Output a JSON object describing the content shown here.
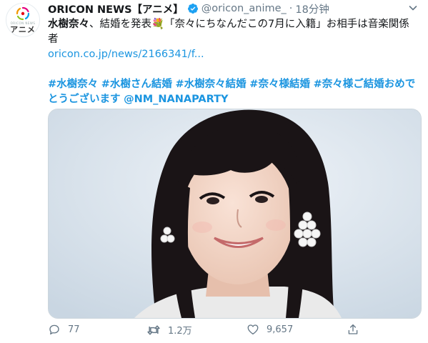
{
  "account": {
    "avatar_top_text": "ORICON NEWS",
    "avatar_label": "アニメ",
    "display_name": "ORICON NEWS【アニメ】",
    "handle": "@oricon_anime_",
    "separator": "·",
    "timestamp": "18分钟"
  },
  "tweet": {
    "bold_name": "水樹奈々",
    "body": "、結婚を発表💐「奈々にちなんだこの7月に入籍」お相手は音楽関係者",
    "link": "oricon.co.jp/news/2166341/f...",
    "hashtags": [
      "#水樹奈々",
      "#水樹さん結婚",
      "#水樹奈々結婚",
      "#奈々様結婚",
      "#奈々様ご結婚おめでとうございます"
    ],
    "mention": "@NM_NANAPARTY"
  },
  "actions": {
    "reply_count": "77",
    "retweet_count": "1.2万",
    "like_count": "9,657"
  },
  "colors": {
    "link": "#1b95e0",
    "secondary_text": "#657786",
    "verified": "#1da1f2"
  }
}
